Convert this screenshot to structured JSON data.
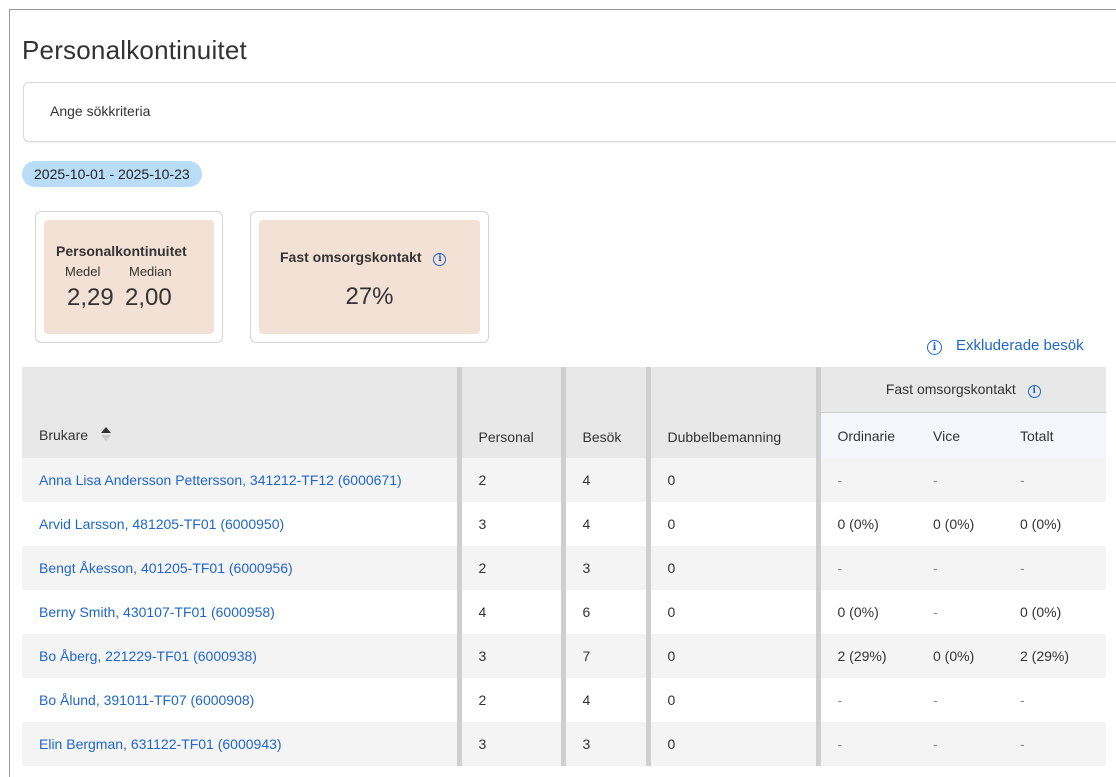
{
  "page": {
    "title": "Personalkontinuitet"
  },
  "search": {
    "label": "Ange sökkriteria"
  },
  "date_range": "2025-10-01 - 2025-10-23",
  "kpis": {
    "personalkontinuitet": {
      "title": "Personalkontinuitet",
      "medel_label": "Medel",
      "median_label": "Median",
      "medel_value": "2,29",
      "median_value": "2,00"
    },
    "fast_omsorgskontakt": {
      "title": "Fast omsorgskontakt",
      "value": "27%"
    }
  },
  "excluded_link": "Exkluderade besök",
  "table": {
    "columns": {
      "brukare": "Brukare",
      "personal": "Personal",
      "besok": "Besök",
      "dubbel": "Dubbelbemanning",
      "group": "Fast omsorgskontakt",
      "ordinarie": "Ordinarie",
      "vice": "Vice",
      "totalt": "Totalt"
    },
    "rows": [
      {
        "brukare": "Anna Lisa Andersson Pettersson, 341212-TF12 (6000671)",
        "personal": "2",
        "besok": "4",
        "dubbel": "0",
        "ordinarie": "-",
        "vice": "-",
        "totalt": "-"
      },
      {
        "brukare": "Arvid Larsson, 481205-TF01 (6000950)",
        "personal": "3",
        "besok": "4",
        "dubbel": "0",
        "ordinarie": "0 (0%)",
        "vice": "0 (0%)",
        "totalt": "0 (0%)"
      },
      {
        "brukare": "Bengt Åkesson, 401205-TF01 (6000956)",
        "personal": "2",
        "besok": "3",
        "dubbel": "0",
        "ordinarie": "-",
        "vice": "-",
        "totalt": "-"
      },
      {
        "brukare": "Berny Smith, 430107-TF01 (6000958)",
        "personal": "4",
        "besok": "6",
        "dubbel": "0",
        "ordinarie": "0 (0%)",
        "vice": "-",
        "totalt": "0 (0%)"
      },
      {
        "brukare": "Bo Åberg, 221229-TF01 (6000938)",
        "personal": "3",
        "besok": "7",
        "dubbel": "0",
        "ordinarie": "2 (29%)",
        "vice": "0 (0%)",
        "totalt": "2 (29%)"
      },
      {
        "brukare": "Bo Ålund, 391011-TF07 (6000908)",
        "personal": "2",
        "besok": "4",
        "dubbel": "0",
        "ordinarie": "-",
        "vice": "-",
        "totalt": "-"
      },
      {
        "brukare": "Elin Bergman, 631122-TF01 (6000943)",
        "personal": "3",
        "besok": "3",
        "dubbel": "0",
        "ordinarie": "-",
        "vice": "-",
        "totalt": "-"
      }
    ]
  }
}
